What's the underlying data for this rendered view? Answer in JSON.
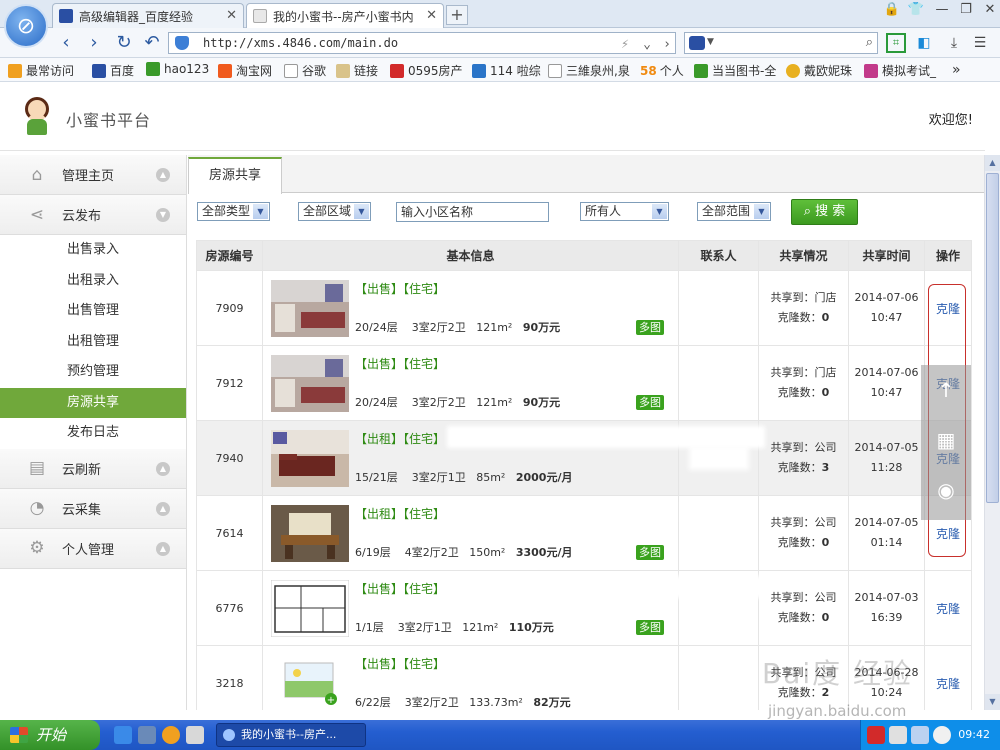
{
  "browser": {
    "tabs": [
      {
        "label": "高级编辑器_百度经验"
      },
      {
        "label": "我的小蜜书--房产小蜜书内"
      }
    ],
    "url": "http://xms.4846.com/main.do",
    "bookmarks": [
      {
        "label": "最常访问",
        "color": "#f0a020"
      },
      {
        "label": "百度",
        "color": "#2a4fa3"
      },
      {
        "label": "hao123",
        "color": "#3a9a2a"
      },
      {
        "label": "淘宝网",
        "color": "#f05a1e"
      },
      {
        "label": "谷歌",
        "color": "#cccccc"
      },
      {
        "label": "链接",
        "color": "#d9c38a"
      },
      {
        "label": "0595房产",
        "color": "#d22a2a"
      },
      {
        "label": "114 啦综",
        "color": "#2a74c8"
      },
      {
        "label": "三維泉州,泉",
        "color": "#cccccc"
      },
      {
        "label": "个人",
        "prefix": "58",
        "color": "#f08a10"
      },
      {
        "label": "当当图书-全",
        "color": "#3a9a2a"
      },
      {
        "label": "戴欧妮珠",
        "color": "#e8b020"
      },
      {
        "label": "模拟考试_",
        "color": "#c23a8a"
      }
    ]
  },
  "header": {
    "title": "小蜜书平台",
    "welcome": "欢迎您!"
  },
  "sidebar": {
    "sections": [
      {
        "label": "管理主页",
        "icon": "home-icon",
        "glyph": "⌂"
      },
      {
        "label": "云发布",
        "icon": "share-icon",
        "glyph": "⋖"
      }
    ],
    "sub_items": [
      {
        "label": "出售录入"
      },
      {
        "label": "出租录入"
      },
      {
        "label": "出售管理"
      },
      {
        "label": "出租管理"
      },
      {
        "label": "预约管理"
      },
      {
        "label": "房源共享"
      },
      {
        "label": "发布日志"
      }
    ],
    "active_sub": "房源共享",
    "more_sections": [
      {
        "label": "云刷新",
        "icon": "printer-icon",
        "glyph": "▤"
      },
      {
        "label": "云采集",
        "icon": "pie-icon",
        "glyph": "◔"
      },
      {
        "label": "个人管理",
        "icon": "gear-icon",
        "glyph": "⚙"
      }
    ]
  },
  "main": {
    "tab": "房源共享",
    "filters": {
      "type": "全部类型",
      "area": "全部区域",
      "community_placeholder": "输入小区名称",
      "owner": "所有人",
      "scope": "全部范围",
      "search_label": "搜 索"
    },
    "columns": [
      "房源编号",
      "基本信息",
      "联系人",
      "共享情况",
      "共享时间",
      "操作"
    ],
    "rows": [
      {
        "id": "7909",
        "tags": "【出售】【住宅】",
        "floor": "20/24层",
        "layout": "3室2厅2卫",
        "size": "121m²",
        "price": "90万元",
        "multi": "多图",
        "share_to": "共享到：门店",
        "clones": "克隆数：",
        "clone_count": "0",
        "date": "2014-07-06",
        "time": "10:47",
        "action": "克隆",
        "gray": false,
        "thumb": "living"
      },
      {
        "id": "7912",
        "tags": "【出售】【住宅】",
        "floor": "20/24层",
        "layout": "3室2厅2卫",
        "size": "121m²",
        "price": "90万元",
        "multi": "多图",
        "share_to": "共享到：门店",
        "clones": "克隆数：",
        "clone_count": "0",
        "date": "2014-07-06",
        "time": "10:47",
        "action": "克隆",
        "gray": false,
        "thumb": "living"
      },
      {
        "id": "7940",
        "tags": "【出租】【住宅】",
        "floor": "15/21层",
        "layout": "3室2厅1卫",
        "size": "85m²",
        "price": "2000元/月",
        "multi": "",
        "share_to": "共享到：公司",
        "clones": "克隆数：",
        "clone_count": "3",
        "date": "2014-07-05",
        "time": "11:28",
        "action": "克隆",
        "gray": true,
        "thumb": "sofa"
      },
      {
        "id": "7614",
        "tags": "【出租】【住宅】",
        "floor": "6/19层",
        "layout": "4室2厅2卫",
        "size": "150m²",
        "price": "3300元/月",
        "multi": "多图",
        "share_to": "共享到：公司",
        "clones": "克隆数：",
        "clone_count": "0",
        "date": "2014-07-05",
        "time": "01:14",
        "action": "克隆",
        "gray": false,
        "thumb": "dining"
      },
      {
        "id": "6776",
        "tags": "【出售】【住宅】",
        "floor": "1/1层",
        "layout": "3室2厅1卫",
        "size": "121m²",
        "price": "110万元",
        "multi": "多图",
        "share_to": "共享到：公司",
        "clones": "克隆数：",
        "clone_count": "0",
        "date": "2014-07-03",
        "time": "16:39",
        "action": "克隆",
        "gray": false,
        "thumb": "plan"
      },
      {
        "id": "3218",
        "tags": "【出售】【住宅】",
        "floor": "6/22层",
        "layout": "3室2厅2卫",
        "size": "133.73m²",
        "price": "82万元",
        "multi": "",
        "share_to": "共享到：公司",
        "clones": "克隆数：",
        "clone_count": "2",
        "date": "2014-06-28",
        "time": "10:24",
        "action": "克隆",
        "gray": false,
        "thumb": "placeholder"
      }
    ]
  },
  "taskbar": {
    "start": "开始",
    "task": "我的小蜜书--房产...",
    "clock": "09:42"
  },
  "watermark": {
    "main": "Bai度 经验",
    "sub": "jingyan.baidu.com"
  }
}
